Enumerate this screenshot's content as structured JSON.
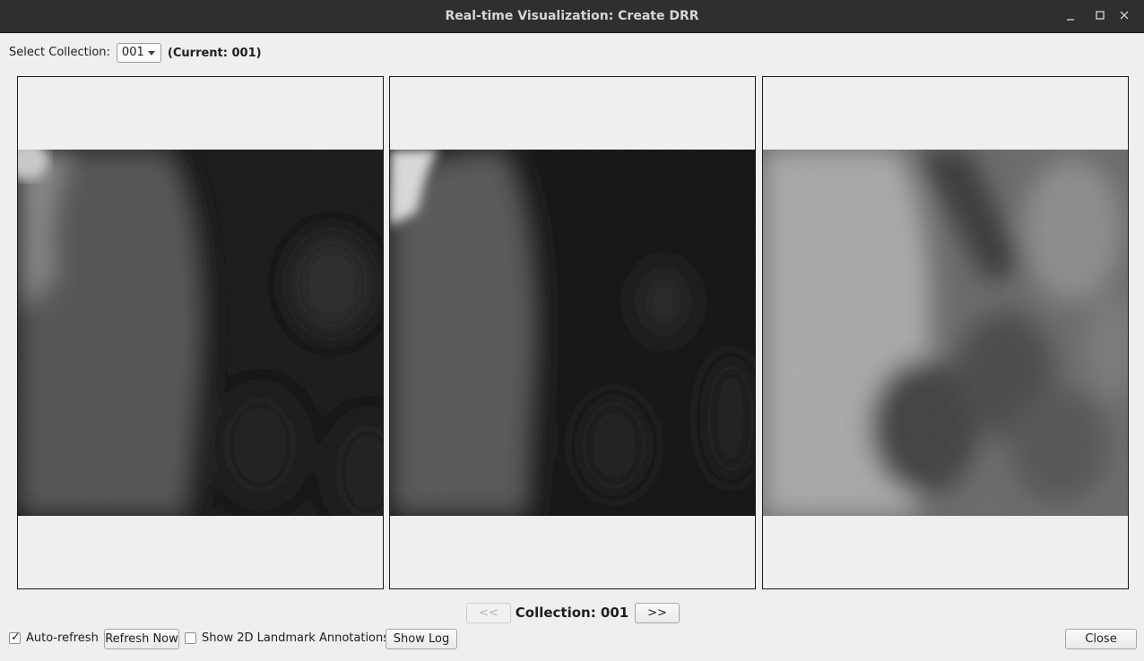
{
  "window": {
    "title": "Real-time Visualization: Create DRR",
    "controls": [
      "minimize-icon",
      "maximize-icon",
      "close-icon"
    ]
  },
  "collection_select": {
    "label": "Select Collection:",
    "selected": "001",
    "current_text": "(Current: 001)"
  },
  "images": [
    {
      "name": "drr-view-1",
      "content": "x-ray radiograph"
    },
    {
      "name": "drr-view-2",
      "content": "x-ray radiograph"
    },
    {
      "name": "drr-view-3",
      "content": "x-ray radiograph"
    }
  ],
  "navigation": {
    "prev_label": "<<",
    "prev_enabled": false,
    "collection_label": "Collection: 001",
    "next_label": ">>"
  },
  "footer": {
    "auto_refresh": {
      "label": "Auto-refresh",
      "checked": true
    },
    "refresh_now_label": "Refresh Now",
    "show_landmarks": {
      "label": "Show 2D Landmark Annotations",
      "checked": false
    },
    "show_log_label": "Show Log",
    "close_label": "Close"
  }
}
